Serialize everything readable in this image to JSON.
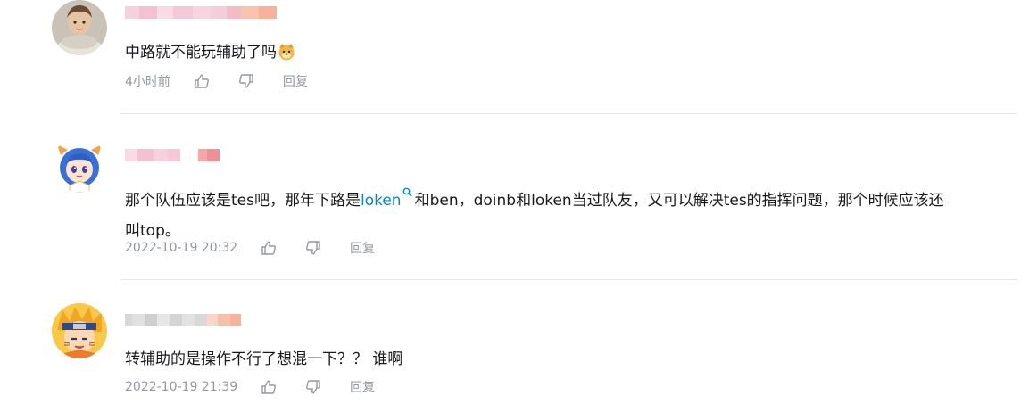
{
  "comments": [
    {
      "avatar": "avatar-guy-scarf",
      "content": "中路就不能玩辅助了吗",
      "emoji": "doge-emoji",
      "time": "4小时前",
      "reply_label": "回复"
    },
    {
      "avatar": "avatar-anime-girl",
      "content_before": "那个队伍应该是tes吧，那年下路是",
      "link_text": "loken",
      "content_after_line1": "和ben，doinb和loken当过队友，又可以解决tes的指挥问题，那个时候应该还",
      "content_line2": "叫top。",
      "time": "2022-10-19 20:32",
      "reply_label": "回复"
    },
    {
      "avatar": "avatar-naruto",
      "content": "转辅助的是操作不行了想混一下？？ 谁啊",
      "time": "2022-10-19 21:39",
      "reply_label": "回复"
    }
  ],
  "icons": {
    "like": "thumbs-up-icon",
    "dislike": "thumbs-down-icon",
    "search": "search-icon"
  },
  "colors": {
    "link": "#008ac5",
    "meta": "#9499a0",
    "divider": "#e3e5e7"
  }
}
